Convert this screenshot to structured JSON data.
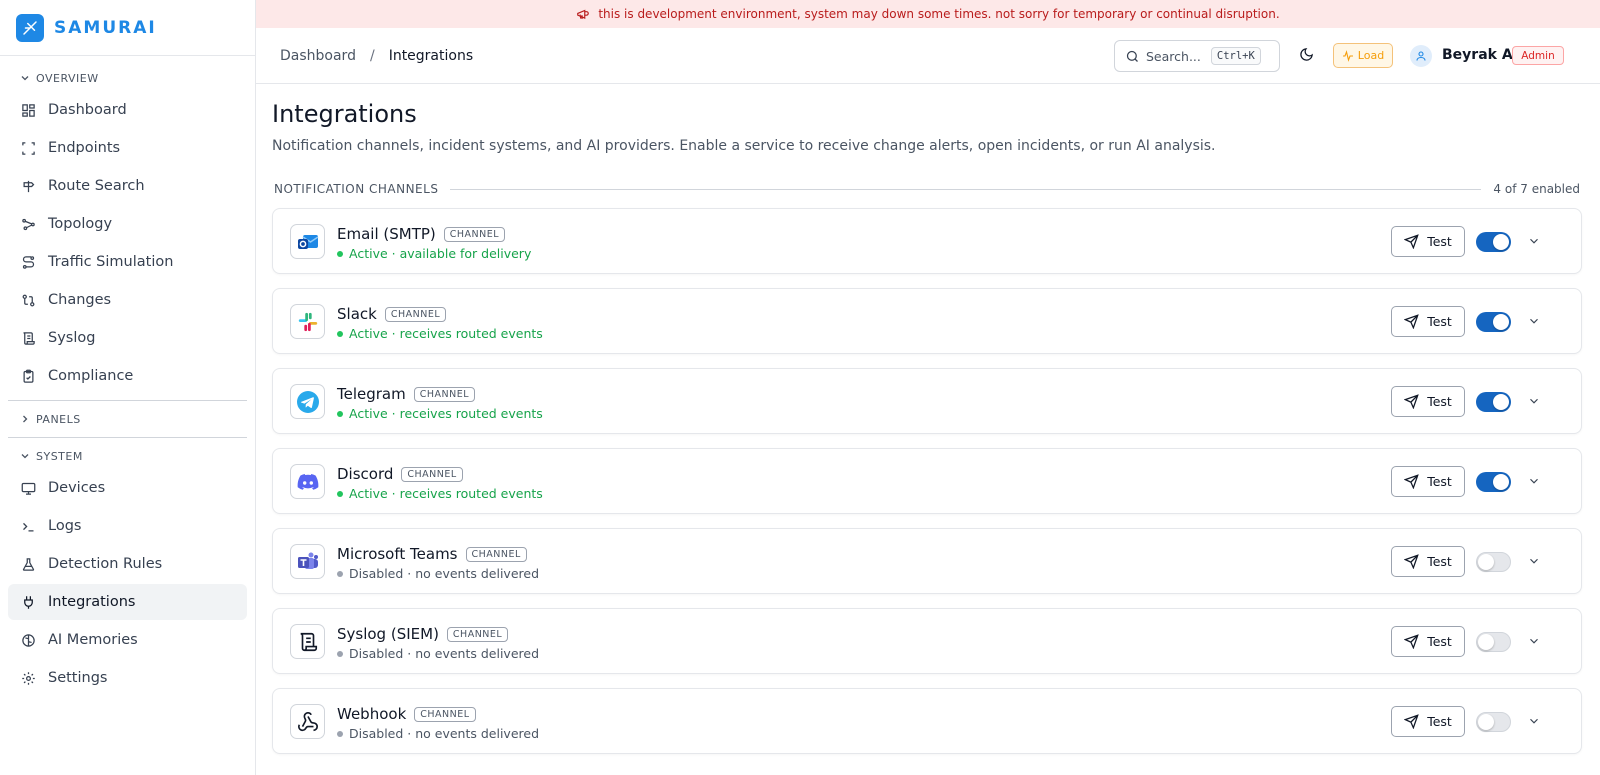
{
  "app": {
    "name": "SAMURAI",
    "brand_color": "#1e88e5"
  },
  "banner": {
    "text": "this is development environment, system may down some times. not sorry for temporary or continual disruption."
  },
  "sidebar": {
    "overview_label": "OVERVIEW",
    "overview_items": [
      {
        "label": "Dashboard",
        "icon": "grid-icon"
      },
      {
        "label": "Endpoints",
        "icon": "scan-icon"
      },
      {
        "label": "Route Search",
        "icon": "signpost-icon"
      },
      {
        "label": "Topology",
        "icon": "topology-icon"
      },
      {
        "label": "Traffic Simulation",
        "icon": "route-icon"
      },
      {
        "label": "Changes",
        "icon": "git-compare-icon"
      },
      {
        "label": "Syslog",
        "icon": "scroll-icon"
      },
      {
        "label": "Compliance",
        "icon": "clipboard-check-icon"
      }
    ],
    "panels_label": "PANELS",
    "system_label": "SYSTEM",
    "system_items": [
      {
        "label": "Devices",
        "icon": "monitor-icon"
      },
      {
        "label": "Logs",
        "icon": "terminal-icon"
      },
      {
        "label": "Detection Rules",
        "icon": "flask-icon"
      },
      {
        "label": "Integrations",
        "icon": "plug-icon",
        "active": true
      },
      {
        "label": "AI Memories",
        "icon": "brain-icon"
      },
      {
        "label": "Settings",
        "icon": "gear-icon"
      }
    ]
  },
  "header": {
    "breadcrumb_root": "Dashboard",
    "breadcrumb_sep": "/",
    "breadcrumb_current": "Integrations",
    "search_placeholder": "Search...",
    "search_shortcut": "Ctrl+K",
    "load_label": "Load",
    "user_name": "Beyrak A.",
    "user_role": "Admin"
  },
  "main": {
    "title": "Integrations",
    "description": "Notification channels, incident systems, and AI providers. Enable a service to receive change alerts, open incidents, or run AI analysis.",
    "group_label": "NOTIFICATION CHANNELS",
    "group_count": "4 of 7 enabled",
    "test_label": "Test",
    "badge_label": "CHANNEL",
    "channels": [
      {
        "name": "Email (SMTP)",
        "status": "Active · available for delivery",
        "enabled": true,
        "icon": "outlook-mail-icon"
      },
      {
        "name": "Slack",
        "status": "Active · receives routed events",
        "enabled": true,
        "icon": "slack-icon"
      },
      {
        "name": "Telegram",
        "status": "Active · receives routed events",
        "enabled": true,
        "icon": "telegram-icon"
      },
      {
        "name": "Discord",
        "status": "Active · receives routed events",
        "enabled": true,
        "icon": "discord-icon"
      },
      {
        "name": "Microsoft Teams",
        "status": "Disabled · no events delivered",
        "enabled": false,
        "icon": "teams-icon"
      },
      {
        "name": "Syslog (SIEM)",
        "status": "Disabled · no events delivered",
        "enabled": false,
        "icon": "scroll-text-icon"
      },
      {
        "name": "Webhook",
        "status": "Disabled · no events delivered",
        "enabled": false,
        "icon": "webhook-icon"
      }
    ]
  },
  "colors": {
    "active_green": "#16a34a",
    "toggle_on": "#1565c0",
    "banner_bg": "#fde8e8",
    "banner_text": "#b91c1c"
  }
}
